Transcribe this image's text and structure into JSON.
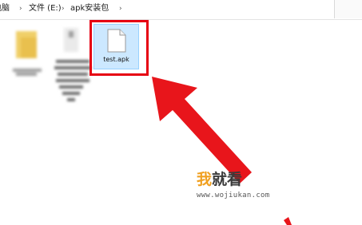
{
  "breadcrumb": {
    "items": [
      {
        "label": "电脑"
      },
      {
        "label": "文件 (E:)"
      },
      {
        "label": "apk安装包"
      }
    ],
    "separator": "›"
  },
  "files": {
    "selected": {
      "name": "test.apk",
      "icon": "file-icon"
    },
    "blurred_count": 2
  },
  "annotation": {
    "highlight_color": "#e60012",
    "arrow": "red-arrow-icon"
  },
  "watermark": {
    "logo_part1": "我",
    "logo_part2": "就看",
    "url": "www.wojiukan.com"
  },
  "colors": {
    "selection_bg": "#cce8ff",
    "selection_border": "#99d1ff",
    "accent_red": "#e60012",
    "logo_orange": "#f0a020"
  }
}
